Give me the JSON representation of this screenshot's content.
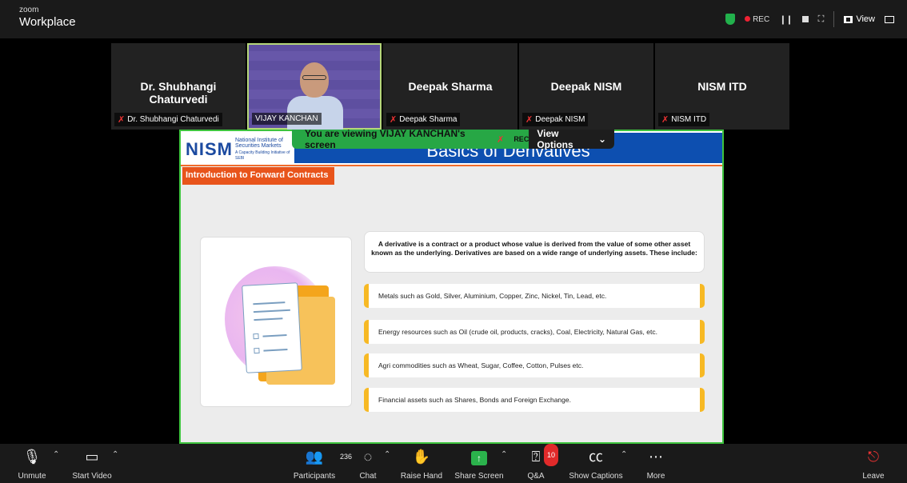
{
  "app": {
    "brand_small": "zoom",
    "brand": "Workplace"
  },
  "topbar": {
    "rec_label": "REC",
    "view_label": "View"
  },
  "participants": [
    {
      "display": "Dr. Shubhangi Chaturvedi",
      "label": "Dr. Shubhangi Chaturvedi",
      "muted": true,
      "video": false
    },
    {
      "display": "",
      "label": "VIJAY KANCHAN",
      "muted": false,
      "video": true
    },
    {
      "display": "Deepak Sharma",
      "label": "Deepak Sharma",
      "muted": true,
      "video": false
    },
    {
      "display": "Deepak NISM",
      "label": "Deepak NISM",
      "muted": true,
      "video": false
    },
    {
      "display": "NISM ITD",
      "label": "NISM ITD",
      "muted": true,
      "video": false
    }
  ],
  "share": {
    "viewing_text": "You are viewing  VIJAY KANCHAN's screen",
    "rec": "REC",
    "view_options": "View Options"
  },
  "slide": {
    "logo_word": "NISM",
    "logo_sub": "National Institute of Securities Markets",
    "logo_tag": "A Capacity Building Initiative of SEBI",
    "title": "Basics of Derivatives",
    "section": "Introduction to Forward Contracts",
    "definition": "A derivative is a contract or a product whose value is derived from the value of some other asset known as the underlying. Derivatives are based on a wide range of underlying assets. These include:",
    "items": [
      "Metals such as Gold, Silver, Aluminium, Copper, Zinc, Nickel, Tin, Lead, etc.",
      "Energy resources such as Oil (crude oil, products, cracks), Coal, Electricity, Natural Gas, etc.",
      "Agri commodities such as Wheat, Sugar, Coffee, Cotton, Pulses etc.",
      "Financial assets such as Shares, Bonds and Foreign Exchange."
    ]
  },
  "toolbar": {
    "unmute": "Unmute",
    "start_video": "Start Video",
    "participants": "Participants",
    "participants_count": "236",
    "chat": "Chat",
    "raise_hand": "Raise Hand",
    "share_screen": "Share Screen",
    "qa": "Q&A",
    "qa_badge": "10",
    "captions": "Show Captions",
    "more": "More",
    "leave": "Leave"
  },
  "icons": {
    "mic": "mic-off-icon",
    "video": "video-off-icon",
    "participants": "people-icon",
    "chat": "chat-icon",
    "hand": "raise-hand-icon",
    "share": "share-screen-icon",
    "qa": "qa-icon",
    "cc": "captions-icon",
    "more": "more-icon",
    "leave": "leave-icon"
  },
  "colors": {
    "green_border": "#3ec43e",
    "slide_blue": "#0d4fb0",
    "slide_orange": "#e8541b",
    "bullet_yellow": "#f7b924",
    "rec_red": "#e22233"
  }
}
